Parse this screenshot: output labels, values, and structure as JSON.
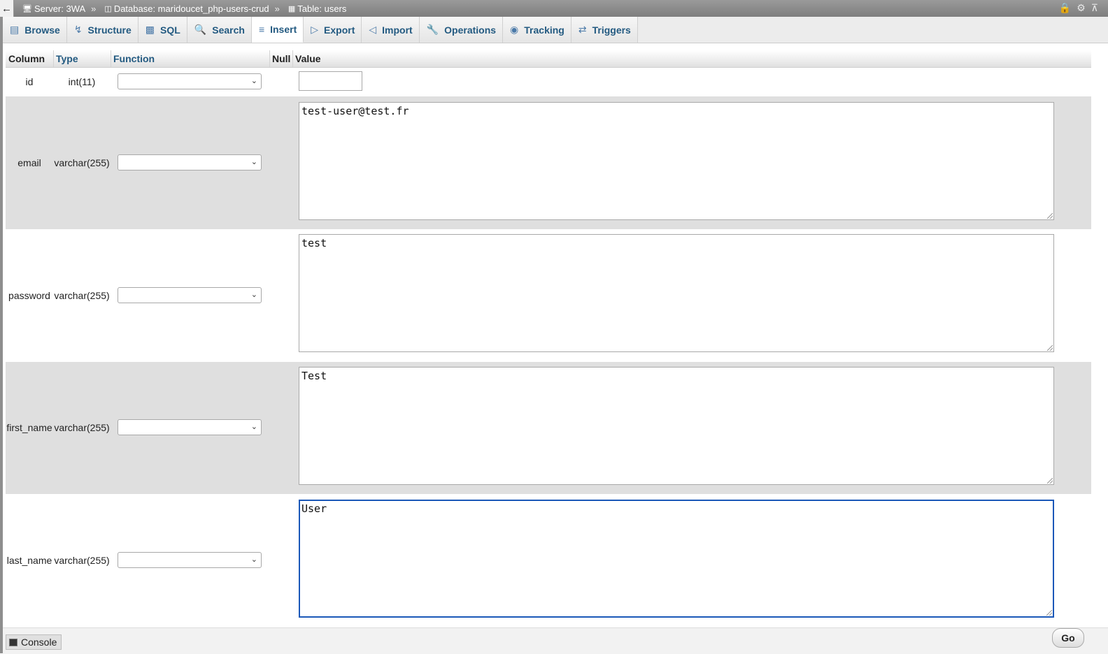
{
  "breadcrumb": {
    "server": "Server: 3WA",
    "separator": "»",
    "database": "Database: maridoucet_php-users-crud",
    "table": "Table: users"
  },
  "tabs": [
    {
      "label": "Browse",
      "icon": "browse-icon"
    },
    {
      "label": "Structure",
      "icon": "structure-icon"
    },
    {
      "label": "SQL",
      "icon": "sql-icon"
    },
    {
      "label": "Search",
      "icon": "search-icon"
    },
    {
      "label": "Insert",
      "icon": "insert-icon",
      "active": true
    },
    {
      "label": "Export",
      "icon": "export-icon"
    },
    {
      "label": "Import",
      "icon": "import-icon"
    },
    {
      "label": "Operations",
      "icon": "wrench-icon"
    },
    {
      "label": "Tracking",
      "icon": "eye-icon"
    },
    {
      "label": "Triggers",
      "icon": "triggers-icon"
    }
  ],
  "table_header": {
    "column": "Column",
    "type": "Type",
    "function": "Function",
    "null": "Null",
    "value": "Value"
  },
  "fields": [
    {
      "name": "id",
      "type": "int(11)",
      "value": ""
    },
    {
      "name": "email",
      "type": "varchar(255)",
      "value": "test-user@test.fr"
    },
    {
      "name": "password",
      "type": "varchar(255)",
      "value": "test"
    },
    {
      "name": "first_name",
      "type": "varchar(255)",
      "value": "Test"
    },
    {
      "name": "last_name",
      "type": "varchar(255)",
      "value": "User"
    }
  ],
  "footer": {
    "console_label": "Console",
    "go_label": "Go"
  },
  "colors": {
    "link": "#235a81",
    "focus": "#1b58b8",
    "alt_row": "#dfdfdf"
  }
}
